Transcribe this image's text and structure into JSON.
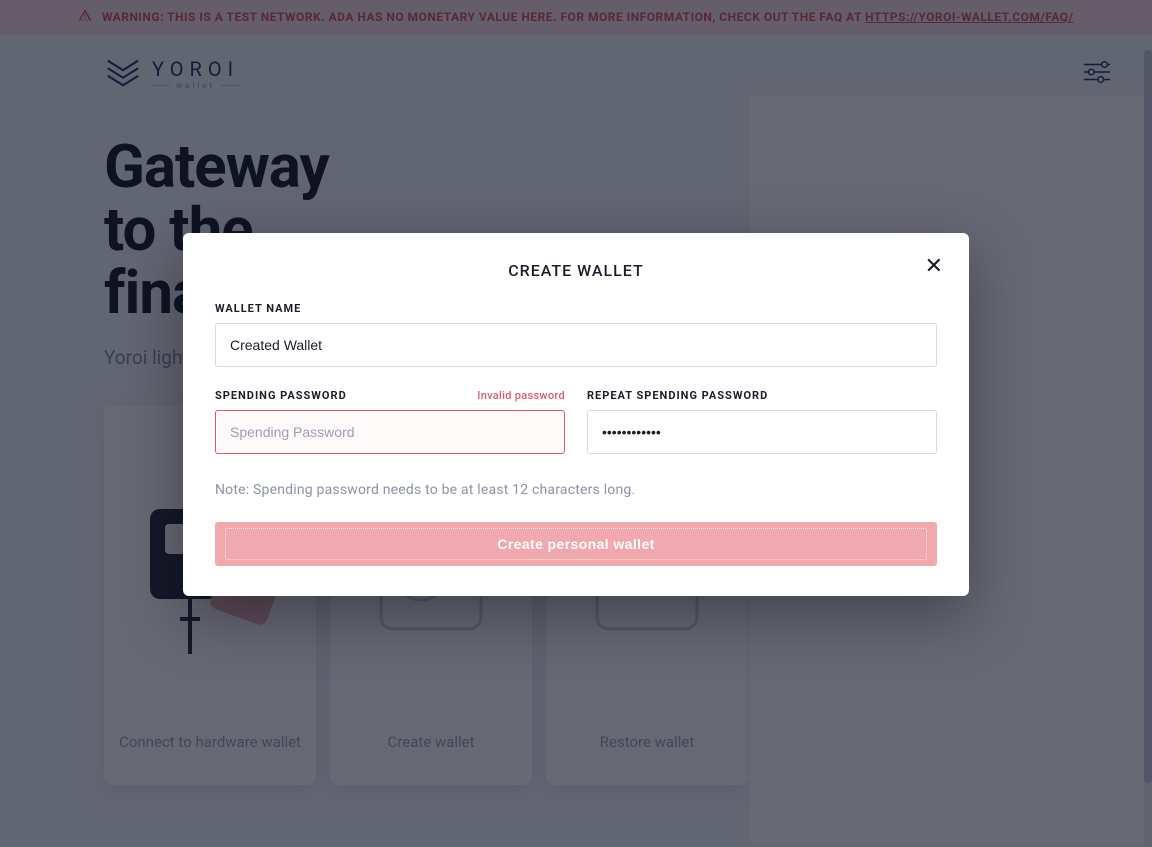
{
  "banner": {
    "text_before_link": "WARNING: THIS IS A TEST NETWORK. ADA HAS NO MONETARY VALUE HERE. FOR MORE INFORMATION, CHECK OUT THE FAQ AT ",
    "link_text": "HTTPS://YOROI-WALLET.COM/FAQ/"
  },
  "brand": {
    "name": "YOROI",
    "sub": "wallet"
  },
  "hero": {
    "title_line1": "Gateway",
    "title_line2": "to the",
    "title_line3": "financial world",
    "subtitle": "Yoroi light wallet for Cardano assets"
  },
  "cards": {
    "hardware": "Connect to hardware wallet",
    "create": "Create wallet",
    "restore": "Restore wallet"
  },
  "modal": {
    "title": "CREATE WALLET",
    "wallet_name_label": "WALLET NAME",
    "wallet_name_value": "Created Wallet",
    "spending_label": "SPENDING PASSWORD",
    "spending_placeholder": "Spending Password",
    "spending_error": "Invalid password",
    "repeat_label": "REPEAT SPENDING PASSWORD",
    "repeat_value": "●●●●●●●●●●●●",
    "note": "Note: Spending password needs to be at least 12 characters long.",
    "submit": "Create personal wallet"
  },
  "colors": {
    "accent_error": "#e2586f",
    "submit_bg": "#f1a8ae",
    "banner_bg": "#fbe3e4",
    "banner_fg": "#d35b5b"
  }
}
